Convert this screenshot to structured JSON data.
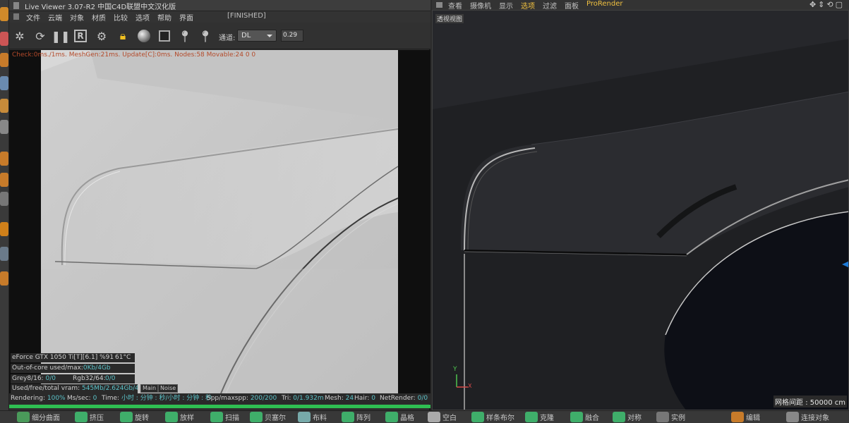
{
  "live_viewer": {
    "title": "Live Viewer 3.07-R2 中国C4D联盟中文汉化版",
    "menu": [
      "文件",
      "云端",
      "对象",
      "材质",
      "比较",
      "选项",
      "帮助",
      "界面"
    ],
    "status_tag": "[FINISHED]",
    "channel_label": "通道:",
    "channel_value": "DL",
    "exposure_value": "0.29",
    "check_line": "Check:0ms./1ms. MeshGen:21ms. Update[C]:0ms. Nodes:58 Movable:24  0 0",
    "gpu": {
      "name": "eForce GTX 1050 Ti[T][6.1] %91",
      "temp": "61°C"
    },
    "out_of_core": {
      "label": "Out-of-core used/max:",
      "value": "0Kb/4Gb"
    },
    "grey": {
      "label": "Grey8/16:",
      "value": "0/0"
    },
    "rgb": {
      "label": "Rgb32/64:",
      "value": "0/0"
    },
    "vram": {
      "label": "Used/free/total vram:",
      "value": "545Mb/2.624Gb/4Gb"
    },
    "tabs": [
      "Main",
      "Noise"
    ],
    "status": {
      "rendering_label": "Rendering:",
      "rendering_value": "100%",
      "ms_sec_label": "Ms/sec:",
      "ms_sec_value": "0",
      "time_label": "Time:",
      "time_value": "小时 : 分钟 : 秒/小时 : 分钟 : 秒",
      "spp_label": "Spp/maxspp:",
      "spp_value": "200/200",
      "tri_label": "Tri:",
      "tri_value": "0/1.932m",
      "mesh_label": "Mesh:",
      "mesh_value": "24",
      "hair_label": "Hair:",
      "hair_value": "0",
      "netrender_label": "NetRender:",
      "netrender_value": "0/0"
    },
    "progress": 1.0
  },
  "viewport": {
    "menu": [
      "查看",
      "摄像机",
      "显示",
      "选项",
      "过滤",
      "面板",
      "ProRender"
    ],
    "active_menu": "选项",
    "label": "透视视图",
    "grid_spacing": "网格间距 : 50000 cm",
    "axis_y": "Y",
    "axis_x": "X"
  },
  "bottom_toolbar": [
    "细分曲面",
    "挤压",
    "旋转",
    "放样",
    "扫描",
    "贝塞尔",
    "布料",
    "阵列",
    "晶格",
    "空白",
    "样条布尔",
    "克隆",
    "融合",
    "对称",
    "实例",
    "",
    "",
    "编辑",
    "连接对象"
  ],
  "colors": {
    "accent": "#f0c040",
    "status_value": "#5bc2c8",
    "progress": "#2fbf52",
    "check_text": "#b44a2a"
  }
}
